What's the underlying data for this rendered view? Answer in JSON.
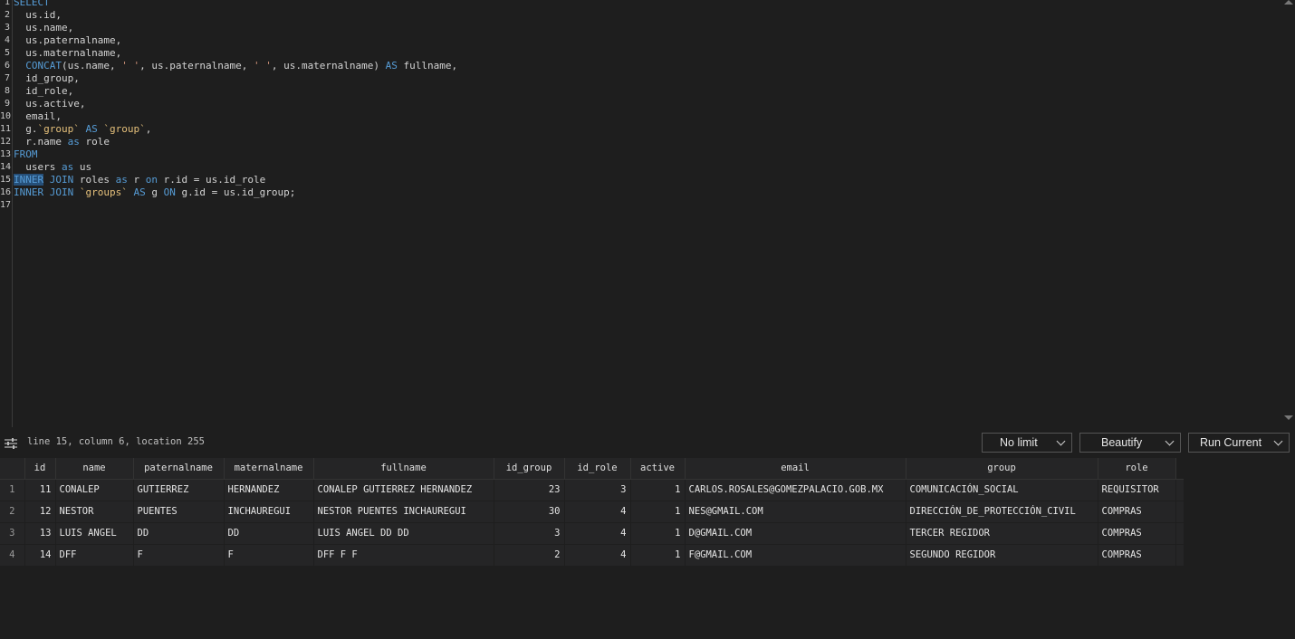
{
  "editor": {
    "line_numbers": [
      "1",
      "2",
      "3",
      "4",
      "5",
      "6",
      "7",
      "8",
      "9",
      "10",
      "11",
      "12",
      "13",
      "14",
      "15",
      "16",
      "17"
    ],
    "lines": [
      [
        {
          "t": "SELECT",
          "c": "kw"
        }
      ],
      [
        {
          "t": "  us.id,",
          "c": ""
        }
      ],
      [
        {
          "t": "  us.name,",
          "c": ""
        }
      ],
      [
        {
          "t": "  us.paternalname,",
          "c": ""
        }
      ],
      [
        {
          "t": "  us.maternalname,",
          "c": ""
        }
      ],
      [
        {
          "t": "  ",
          "c": ""
        },
        {
          "t": "CONCAT",
          "c": "kw"
        },
        {
          "t": "(us.name, ",
          "c": ""
        },
        {
          "t": "' '",
          "c": "str"
        },
        {
          "t": ", us.paternalname, ",
          "c": ""
        },
        {
          "t": "' '",
          "c": "str"
        },
        {
          "t": ", us.maternalname) ",
          "c": ""
        },
        {
          "t": "AS",
          "c": "kw"
        },
        {
          "t": " fullname,",
          "c": ""
        }
      ],
      [
        {
          "t": "  id_group,",
          "c": ""
        }
      ],
      [
        {
          "t": "  id_role,",
          "c": ""
        }
      ],
      [
        {
          "t": "  us.active,",
          "c": ""
        }
      ],
      [
        {
          "t": "  email,",
          "c": ""
        }
      ],
      [
        {
          "t": "  g.",
          "c": ""
        },
        {
          "t": "`group`",
          "c": "bt"
        },
        {
          "t": " ",
          "c": ""
        },
        {
          "t": "AS",
          "c": "kw"
        },
        {
          "t": " ",
          "c": ""
        },
        {
          "t": "`group`",
          "c": "bt"
        },
        {
          "t": ",",
          "c": ""
        }
      ],
      [
        {
          "t": "  r.name ",
          "c": ""
        },
        {
          "t": "as",
          "c": "kw"
        },
        {
          "t": " role",
          "c": ""
        }
      ],
      [
        {
          "t": "FROM",
          "c": "kw"
        }
      ],
      [
        {
          "t": "  users ",
          "c": ""
        },
        {
          "t": "as",
          "c": "kw"
        },
        {
          "t": " us",
          "c": ""
        }
      ],
      [
        {
          "t": "INNER",
          "c": "kw sel"
        },
        {
          "t": " ",
          "c": ""
        },
        {
          "t": "JOIN",
          "c": "kw"
        },
        {
          "t": " roles ",
          "c": ""
        },
        {
          "t": "as",
          "c": "kw"
        },
        {
          "t": " r ",
          "c": ""
        },
        {
          "t": "on",
          "c": "kw"
        },
        {
          "t": " r.id = us.id_role",
          "c": ""
        }
      ],
      [
        {
          "t": "INNER",
          "c": "kw"
        },
        {
          "t": " ",
          "c": ""
        },
        {
          "t": "JOIN",
          "c": "kw"
        },
        {
          "t": " ",
          "c": ""
        },
        {
          "t": "`groups`",
          "c": "bt"
        },
        {
          "t": " ",
          "c": ""
        },
        {
          "t": "AS",
          "c": "kw"
        },
        {
          "t": " g ",
          "c": ""
        },
        {
          "t": "ON",
          "c": "kw"
        },
        {
          "t": " g.id = us.id_group;",
          "c": ""
        }
      ],
      []
    ]
  },
  "status": {
    "cursor_info": "line 15, column 6, location 255",
    "limit_label": "No limit",
    "beautify_label": "Beautify",
    "run_label": "Run Current"
  },
  "results": {
    "columns": [
      "id",
      "name",
      "paternalname",
      "maternalname",
      "fullname",
      "id_group",
      "id_role",
      "active",
      "email",
      "group",
      "role"
    ],
    "rows": [
      {
        "n": "1",
        "cells": [
          "11",
          "CONALEP",
          "GUTIERREZ",
          "HERNANDEZ",
          "CONALEP GUTIERREZ HERNANDEZ",
          "23",
          "3",
          "1",
          "CARLOS.ROSALES@GOMEZPALACIO.GOB.MX",
          "COMUNICACIÓN_SOCIAL",
          "REQUISITOR"
        ]
      },
      {
        "n": "2",
        "cells": [
          "12",
          "NESTOR",
          "PUENTES",
          "INCHAUREGUI",
          "NESTOR PUENTES INCHAUREGUI",
          "30",
          "4",
          "1",
          "NES@GMAIL.COM",
          "DIRECCIÓN_DE_PROTECCIÓN_CIVIL",
          "COMPRAS"
        ]
      },
      {
        "n": "3",
        "cells": [
          "13",
          "LUIS ANGEL",
          "DD",
          "DD",
          "LUIS ANGEL DD DD",
          "3",
          "4",
          "1",
          "D@GMAIL.COM",
          "TERCER REGIDOR",
          "COMPRAS"
        ]
      },
      {
        "n": "4",
        "cells": [
          "14",
          "DFF",
          "F",
          "F",
          "DFF F F",
          "2",
          "4",
          "1",
          "F@GMAIL.COM",
          "SEGUNDO REGIDOR",
          "COMPRAS"
        ]
      }
    ]
  }
}
